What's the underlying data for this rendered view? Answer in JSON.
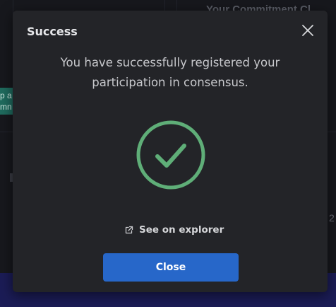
{
  "background": {
    "commitment_title": "Your Commitment Cl",
    "teal_badge_lines": [
      "p a",
      "mn"
    ],
    "right_number": "2",
    "colors": {
      "backdrop": "#17181d",
      "bottom_bar": "#1b1c56",
      "badge": "#1f6b5e"
    }
  },
  "modal": {
    "title": "Success",
    "close_icon": "close-icon",
    "message": "You have successfully registered your participation in consensus.",
    "status_icon": "check-circle-icon",
    "explorer_link": {
      "icon": "external-link-icon",
      "label": "See on explorer"
    },
    "close_button_label": "Close",
    "colors": {
      "surface": "#232428",
      "success": "#5fae78",
      "primary": "#2767c9"
    }
  }
}
